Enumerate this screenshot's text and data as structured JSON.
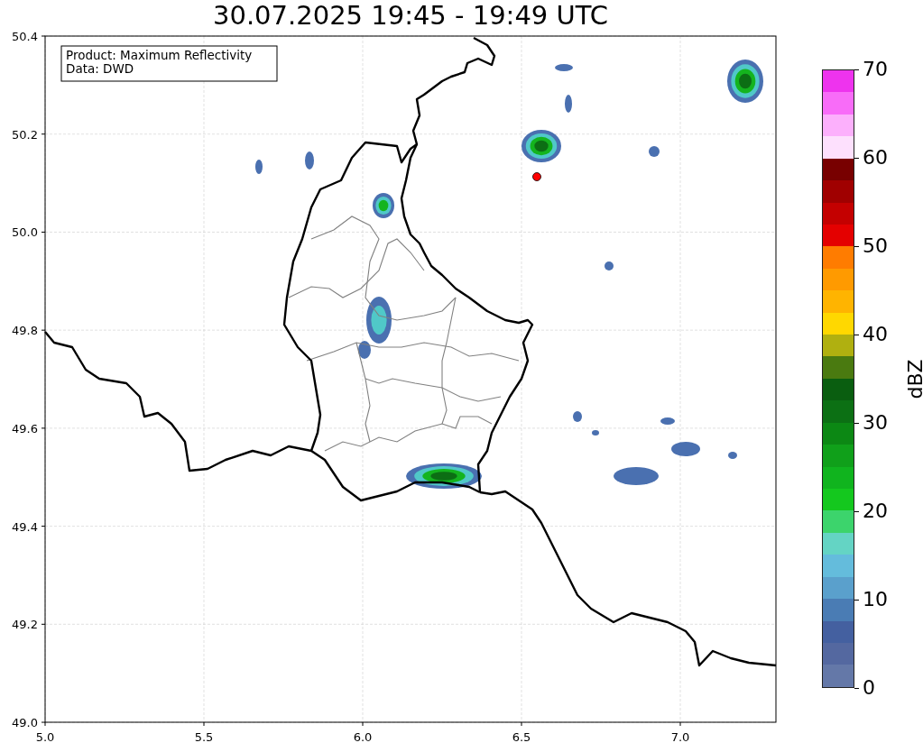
{
  "title": "30.07.2025 19:45 - 19:49 UTC",
  "info_box": [
    "Product: Maximum Reflectivity",
    "Data: DWD"
  ],
  "map": {
    "xticks": [
      "5.0",
      "5.5",
      "6.0",
      "6.5",
      "7.0"
    ],
    "yticks": [
      "50.4",
      "50.2",
      "50.0",
      "49.8",
      "49.6",
      "49.4",
      "49.2",
      "49.0"
    ]
  },
  "colorbar": {
    "label": "dBZ",
    "ticks": [
      "70",
      "60",
      "50",
      "40",
      "30",
      "20",
      "10",
      "0"
    ],
    "bins": [
      {
        "color": "#ee33ee"
      },
      {
        "color": "#f86cf8"
      },
      {
        "color": "#fcb0fc"
      },
      {
        "color": "#fde0fd"
      },
      {
        "color": "#780000"
      },
      {
        "color": "#a00000"
      },
      {
        "color": "#c40000"
      },
      {
        "color": "#e40000"
      },
      {
        "color": "#ff7c00"
      },
      {
        "color": "#ff9a00"
      },
      {
        "color": "#ffb400"
      },
      {
        "color": "#ffd800"
      },
      {
        "color": "#b0b010"
      },
      {
        "color": "#4a7a10"
      },
      {
        "color": "#0a5e10"
      },
      {
        "color": "#0c7014"
      },
      {
        "color": "#0c8814"
      },
      {
        "color": "#10a01a"
      },
      {
        "color": "#10b41e"
      },
      {
        "color": "#14c81e"
      },
      {
        "color": "#3cd46c"
      },
      {
        "color": "#64d4c4"
      },
      {
        "color": "#64bcdc"
      },
      {
        "color": "#5aa0cc"
      },
      {
        "color": "#4a7cb4"
      },
      {
        "color": "#4460a0"
      },
      {
        "color": "#5468a0"
      },
      {
        "color": "#6478a8"
      }
    ]
  }
}
